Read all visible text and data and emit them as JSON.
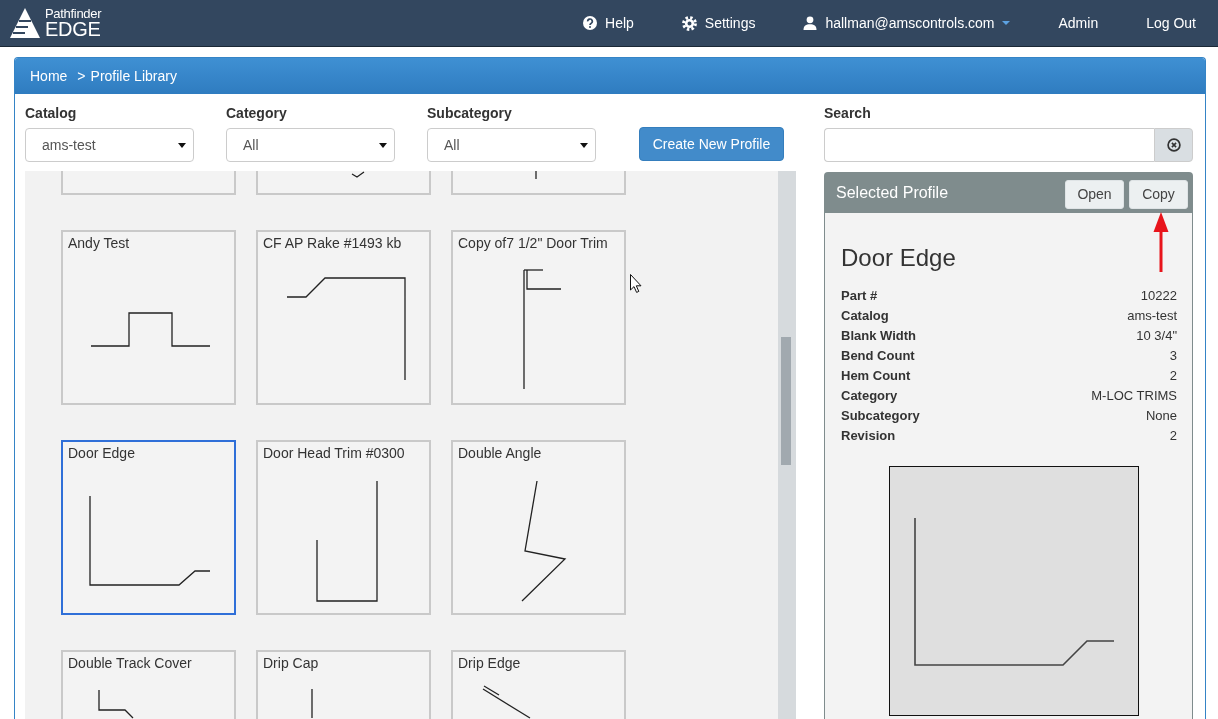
{
  "navbar": {
    "brand_top": "Pathfinder",
    "brand_bottom": "EDGE",
    "items": [
      {
        "label": "Help",
        "kind": "help"
      },
      {
        "label": "Settings",
        "kind": "settings"
      },
      {
        "label": "hallman@amscontrols.com",
        "kind": "account"
      },
      {
        "label": "Admin",
        "kind": "link"
      },
      {
        "label": "Log Out",
        "kind": "link"
      }
    ]
  },
  "breadcrumb": {
    "links": [
      "Home"
    ],
    "separator": ">",
    "current": "Profile Library"
  },
  "filters": [
    {
      "label": "Catalog",
      "value": "ams-test"
    },
    {
      "label": "Category",
      "value": "All"
    },
    {
      "label": "Subcategory",
      "value": "All"
    }
  ],
  "create_button": "Create New Profile",
  "search": {
    "label": "Search"
  },
  "profiles": [
    {
      "selected": false
    },
    {
      "selected": false
    },
    {
      "selected": false
    },
    {
      "title": "Andy Test",
      "selected": false
    },
    {
      "title": "CF AP Rake #1493 kb",
      "selected": false
    },
    {
      "title": "Copy of7 1/2\" Door Trim",
      "selected": false
    },
    {
      "title": "Door Edge",
      "selected": true
    },
    {
      "title": "Door Head Trim #0300",
      "selected": false
    },
    {
      "title": "Double Angle",
      "selected": false
    },
    {
      "title": "Double Track Cover",
      "selected": false
    },
    {
      "title": "Drip Cap",
      "selected": false
    },
    {
      "title": "Drip Edge",
      "selected": false
    }
  ],
  "selected_profile": {
    "heading": "Selected Profile",
    "buttons": [
      "Open",
      "Copy"
    ],
    "name": "Door Edge",
    "details": [
      {
        "label": "Part #",
        "value": "10222"
      },
      {
        "label": "Catalog",
        "value": "ams-test"
      },
      {
        "label": "Blank Width",
        "value": "10 3/4\""
      },
      {
        "label": "Bend Count",
        "value": "3"
      },
      {
        "label": "Hem Count",
        "value": "2"
      },
      {
        "label": "Category",
        "value": "M-LOC TRIMS"
      },
      {
        "label": "Subcategory",
        "value": "None"
      },
      {
        "label": "Revision",
        "value": "2"
      }
    ]
  }
}
